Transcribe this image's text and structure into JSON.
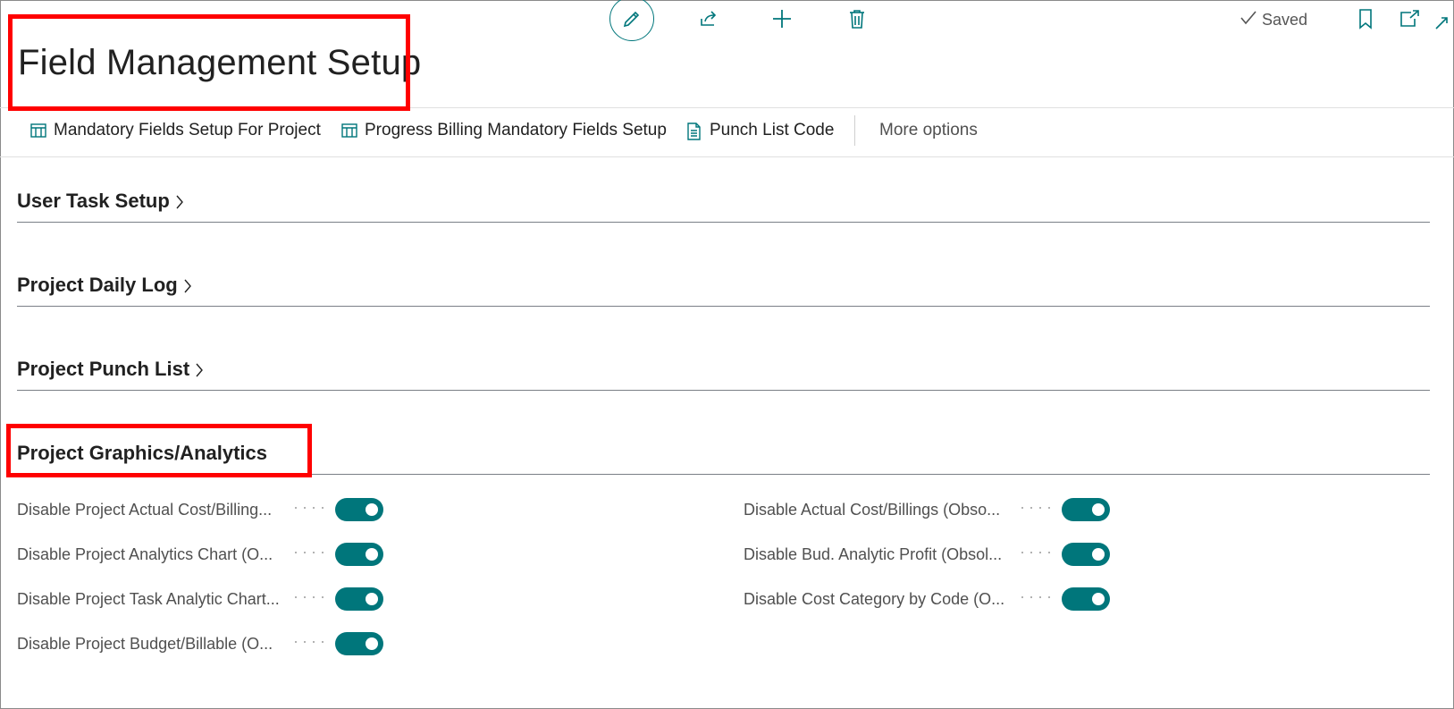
{
  "page": {
    "title": "Field Management Setup",
    "status": "Saved"
  },
  "toolbar": {
    "icons": [
      "edit-icon",
      "share-icon",
      "new-icon",
      "delete-icon",
      "bookmark-icon",
      "open-new-window-icon",
      "collapse-icon"
    ]
  },
  "actions": {
    "items": [
      {
        "label": "Mandatory Fields Setup For Project",
        "icon": "table-icon"
      },
      {
        "label": "Progress Billing Mandatory Fields Setup",
        "icon": "table-icon"
      },
      {
        "label": "Punch List Code",
        "icon": "document-icon"
      }
    ],
    "more_label": "More options"
  },
  "sections": [
    {
      "title": "User Task Setup",
      "collapsed": true
    },
    {
      "title": "Project Daily Log",
      "collapsed": true
    },
    {
      "title": "Project Punch List",
      "collapsed": true
    },
    {
      "title": "Project Graphics/Analytics",
      "collapsed": false
    }
  ],
  "fields": {
    "left": [
      {
        "label": "Disable Project Actual Cost/Billing...",
        "value": true
      },
      {
        "label": "Disable Project Analytics Chart (O...",
        "value": true
      },
      {
        "label": "Disable Project Task Analytic Chart...",
        "value": true
      },
      {
        "label": "Disable Project Budget/Billable (O...",
        "value": true
      }
    ],
    "right": [
      {
        "label": "Disable Actual Cost/Billings (Obso...",
        "value": true
      },
      {
        "label": "Disable Bud. Analytic Profit (Obsol...",
        "value": true
      },
      {
        "label": "Disable Cost Category by Code (O...",
        "value": true
      }
    ]
  },
  "colors": {
    "accent": "#00767b",
    "highlight": "#ff0000"
  }
}
